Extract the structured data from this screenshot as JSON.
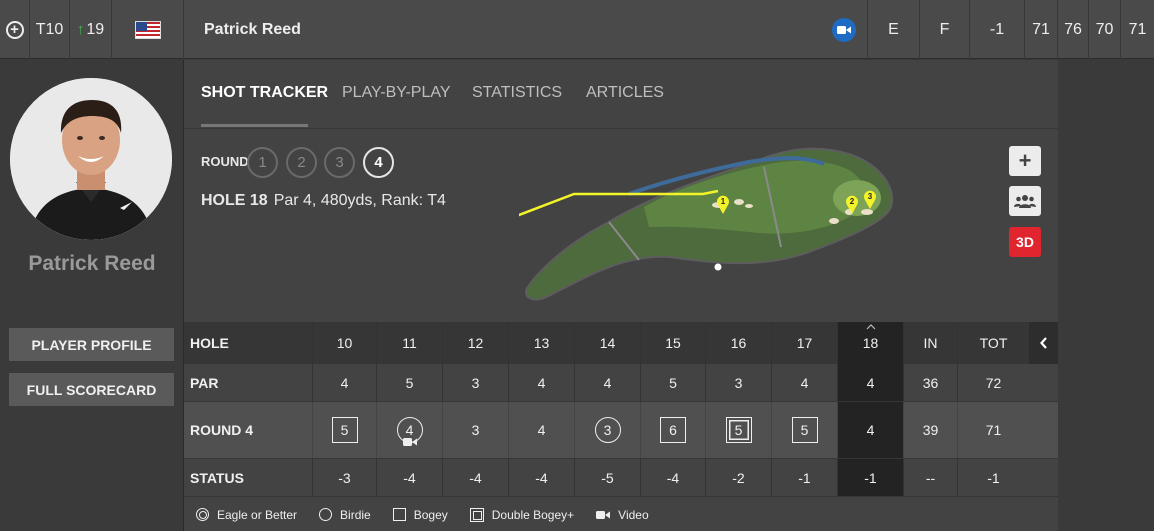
{
  "topbar": {
    "position": "T10",
    "movement": "19",
    "player_name": "Patrick Reed",
    "total": "E",
    "thru": "F",
    "today": "-1",
    "rounds": [
      "71",
      "76",
      "70",
      "71"
    ]
  },
  "player": {
    "name": "Patrick Reed",
    "buttons": {
      "profile": "PLAYER PROFILE",
      "scorecard": "FULL SCORECARD"
    }
  },
  "tabs": [
    "SHOT TRACKER",
    "PLAY-BY-PLAY",
    "STATISTICS",
    "ARTICLES"
  ],
  "round_selector": {
    "label": "ROUND",
    "rounds": [
      "1",
      "2",
      "3",
      "4"
    ],
    "active": "4"
  },
  "hole_info": {
    "hole": "HOLE 18",
    "details": "Par 4, 480yds, Rank: T4"
  },
  "map": {
    "shots": [
      "1",
      "2",
      "3"
    ]
  },
  "controls": {
    "three_d": "3D"
  },
  "scorecard": {
    "labels": {
      "hole": "HOLE",
      "par": "PAR",
      "round": "ROUND 4",
      "status": "STATUS"
    },
    "holes": [
      "10",
      "11",
      "12",
      "13",
      "14",
      "15",
      "16",
      "17",
      "18",
      "IN",
      "TOT"
    ],
    "par": [
      "4",
      "5",
      "3",
      "4",
      "4",
      "5",
      "3",
      "4",
      "4",
      "36",
      "72"
    ],
    "round": [
      "5",
      "4",
      "3",
      "4",
      "3",
      "6",
      "5",
      "5",
      "4",
      "39",
      "71"
    ],
    "status": [
      "-3",
      "-4",
      "-4",
      "-4",
      "-5",
      "-4",
      "-2",
      "-1",
      "-1",
      "--",
      "-1"
    ]
  },
  "legend": {
    "eagle": "Eagle or Better",
    "birdie": "Birdie",
    "bogey": "Bogey",
    "double": "Double Bogey+",
    "video": "Video"
  },
  "colors": {
    "accent_red": "#e0252e",
    "video_blue": "#1e6bc4",
    "up_green": "#3fb64a",
    "shot_line": "#f3f32a"
  }
}
